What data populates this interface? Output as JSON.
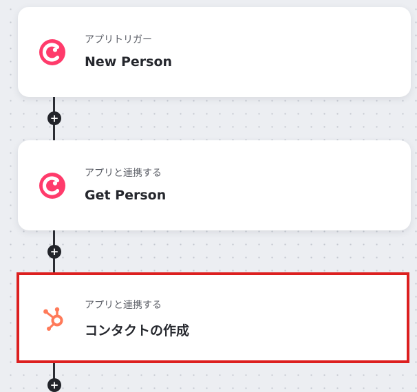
{
  "flow": {
    "steps": [
      {
        "sublabel": "アプリトリガー",
        "title": "New Person",
        "icon": "capsule-crm-icon",
        "icon_color": "#ff3b6b"
      },
      {
        "sublabel": "アプリと連携する",
        "title": "Get Person",
        "icon": "capsule-crm-icon",
        "icon_color": "#ff3b6b"
      },
      {
        "sublabel": "アプリと連携する",
        "title": "コンタクトの作成",
        "icon": "hubspot-icon",
        "icon_color": "#ff7a59",
        "selected": true,
        "highlight_color": "#dc1f1f"
      }
    ],
    "add_step_symbol": "+"
  }
}
